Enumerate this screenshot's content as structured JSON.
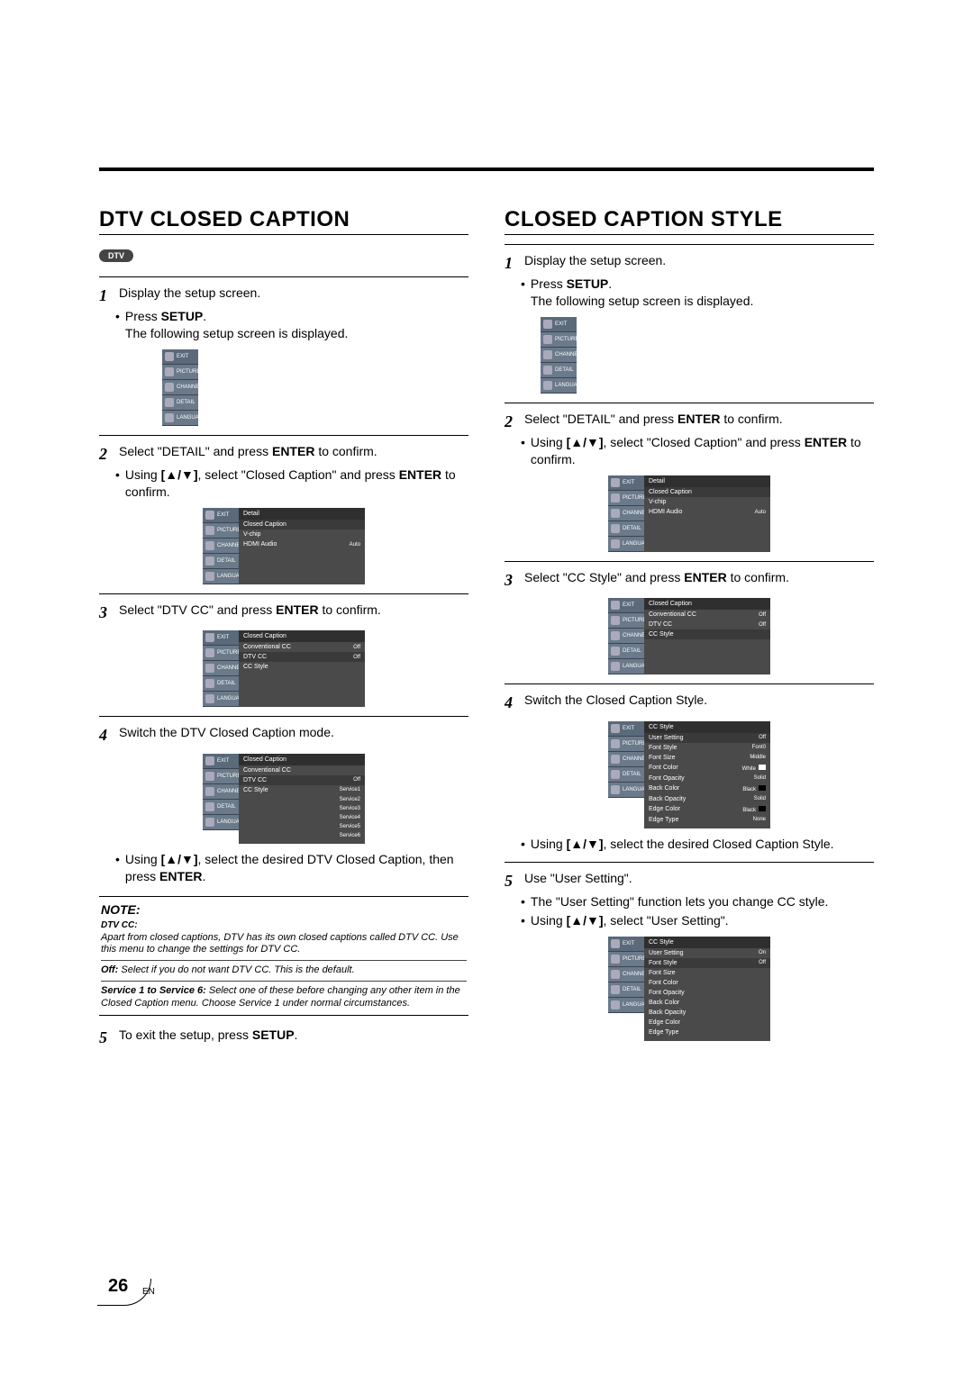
{
  "page": {
    "number": "26",
    "lang": "EN"
  },
  "sidebar": {
    "items": [
      "EXIT",
      "PICTURE",
      "CHANNEL",
      "DETAIL",
      "LANGUAGE"
    ]
  },
  "left": {
    "title": "DTV CLOSED CAPTION",
    "badge": "DTV",
    "step1": {
      "text": "Display the setup screen.",
      "bullet": "Press ",
      "setup": "SETUP",
      "follow": "The following setup screen is displayed."
    },
    "step2": {
      "text_a": "Select \"DETAIL\" and press ",
      "enter": "ENTER",
      "text_b": " to confirm.",
      "bullet_a": "Using ",
      "arrows": "[▲/▼]",
      "bullet_b": ", select \"Closed Caption\" and press ",
      "bullet_c": " to confirm.",
      "osd_header": "Detail",
      "osd_items": [
        "Closed Caption",
        "V-chip",
        "HDMI Audio"
      ],
      "osd_values": [
        "",
        "",
        "Auto"
      ]
    },
    "step3": {
      "text_a": "Select \"DTV CC\" and press ",
      "text_b": " to confirm.",
      "osd_header": "Closed Caption",
      "osd_items": [
        "Conventional CC",
        "DTV CC",
        "CC Style"
      ],
      "osd_values": [
        "Off",
        "Off",
        ""
      ]
    },
    "step4": {
      "text": "Switch the DTV Closed Caption mode.",
      "osd_header": "Closed Caption",
      "osd_items": [
        "Conventional CC",
        "DTV CC",
        "CC Style"
      ],
      "osd_sub": [
        "Off",
        "Service1",
        "Service2",
        "Service3",
        "Service4",
        "Service5",
        "Service6"
      ],
      "bullet_a": "Using ",
      "bullet_b": ", select the desired DTV Closed Caption, then press "
    },
    "note": {
      "title": "NOTE:",
      "sub": "DTV CC:",
      "body1": "Apart from closed captions, DTV has its own closed captions called DTV CC. Use this menu to change the settings for DTV CC.",
      "off_label": "Off:",
      "off_text": " Select if you do not want DTV CC. This is the default.",
      "svc_label": "Service 1 to Service 6:",
      "svc_text": " Select one of these before changing any other item in the Closed Caption menu. Choose Service 1 under normal circumstances."
    },
    "step5": {
      "text_a": "To exit the setup, press ",
      "setup": "SETUP",
      "text_b": "."
    }
  },
  "right": {
    "title": "CLOSED CAPTION STYLE",
    "step1": {
      "text": "Display the setup screen.",
      "bullet": "Press ",
      "follow": "The following setup screen is displayed."
    },
    "step2": {
      "text_a": "Select \"DETAIL\" and press ",
      "text_b": " to confirm.",
      "bullet_a": "Using ",
      "bullet_b": ", select \"Closed Caption\" and press ",
      "bullet_c": " to confirm.",
      "osd_header": "Detail",
      "osd_items": [
        "Closed Caption",
        "V-chip",
        "HDMI Audio"
      ],
      "osd_values": [
        "",
        "",
        "Auto"
      ]
    },
    "step3": {
      "text_a": "Select \"CC Style\" and press  ",
      "text_b": " to confirm.",
      "osd_header": "Closed Caption",
      "osd_items": [
        "Conventional CC",
        "DTV CC",
        "CC Style"
      ],
      "osd_values": [
        "Off",
        "Off",
        ""
      ]
    },
    "step4": {
      "text": "Switch the Closed Caption Style.",
      "osd_header": "CC Style",
      "osd_items": [
        "User Setting",
        "Font Style",
        "Font Size",
        "Font Color",
        "Font Opacity",
        "Back Color",
        "Back Opacity",
        "Edge Color",
        "Edge Type"
      ],
      "osd_values": [
        "Off",
        "Font0",
        "Middle",
        "White",
        "Solid",
        "Black",
        "Solid",
        "Black",
        "None"
      ],
      "bullet_a": "Using ",
      "bullet_b": ", select the desired Closed Caption Style."
    },
    "step5": {
      "text": "Use \"User Setting\".",
      "bullet1": "The \"User Setting\" function lets you change CC style.",
      "bullet2_a": "Using ",
      "bullet2_b": ", select \"User Setting\".",
      "osd_header": "CC Style",
      "osd_items": [
        "User Setting",
        "Font Style",
        "Font Size",
        "Font Color",
        "Font Opacity",
        "Back Color",
        "Back Opacity",
        "Edge Color",
        "Edge Type"
      ],
      "osd_values": [
        "On",
        "Off",
        "",
        "",
        "",
        "",
        "",
        "",
        ""
      ]
    }
  },
  "words": {
    "enter": "ENTER",
    "setup": "SETUP",
    "enter_bracket_open": "[",
    "enter_bracket_close": "]",
    "arrows": "[▲/▼]"
  }
}
